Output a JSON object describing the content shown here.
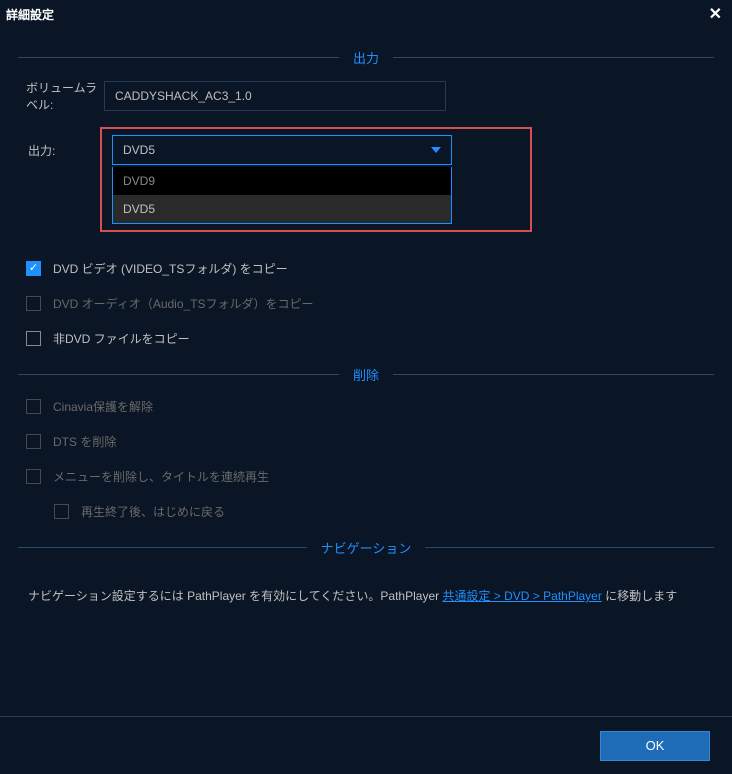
{
  "window": {
    "title": "詳細設定"
  },
  "sections": {
    "output": "出力",
    "remove": "削除",
    "navigation": "ナビゲーション"
  },
  "fields": {
    "volume_label_label": "ボリュームラベル:",
    "volume_label_value": "CADDYSHACK_AC3_1.0",
    "output_label": "出力:",
    "output_selected": "DVD5",
    "output_options": {
      "opt1": "DVD9",
      "opt2": "DVD5"
    }
  },
  "copy_options": {
    "video": "DVD ビデオ (VIDEO_TSフォルダ) をコピー",
    "audio": "DVD オーディオ（Audio_TSフォルダ）をコピー",
    "nondvd": "非DVD ファイルをコピー"
  },
  "remove_options": {
    "cinavia": "Cinavia保護を解除",
    "dts": "DTS を削除",
    "menu": "メニューを削除し、タイトルを連続再生",
    "repeat": "再生終了後、はじめに戻る"
  },
  "navigation_text": {
    "prefix": "ナビゲーション設定するには PathPlayer を有効にしてください。PathPlayer ",
    "link": "共通設定 > DVD > PathPlayer",
    "suffix": " に移動します"
  },
  "buttons": {
    "ok": "OK"
  }
}
